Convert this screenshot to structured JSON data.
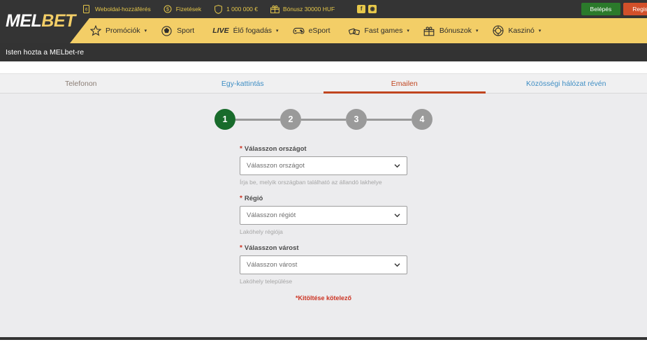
{
  "topbar": {
    "util_items": [
      {
        "icon": "mobile-access-icon",
        "label": "Weboldal-hozzáférés"
      },
      {
        "icon": "payments-dollar-icon",
        "label": "Fizetések"
      },
      {
        "icon": "shield-jackpot-icon",
        "label": "1 000 000 €"
      },
      {
        "icon": "gift-bonus-icon",
        "label": "Bónusz 30000 HUF"
      }
    ],
    "social": [
      {
        "icon": "facebook-icon",
        "glyph": "f"
      },
      {
        "icon": "instagram-icon",
        "glyph": "◉"
      }
    ],
    "login_label": "Belépés",
    "register_label": "Regis"
  },
  "brand": {
    "logo_part1": "MEL",
    "logo_part2": "BET"
  },
  "nav": {
    "items": [
      {
        "icon": "star-icon",
        "label": "Promóciók",
        "caret": "▾",
        "live": ""
      },
      {
        "icon": "soccer-ball-icon",
        "label": "Sport",
        "caret": "",
        "live": ""
      },
      {
        "icon": "live-text-icon",
        "label": "Élő fogadás",
        "caret": "▾",
        "live": "LIVE"
      },
      {
        "icon": "gamepad-icon",
        "label": "eSport",
        "caret": "",
        "live": ""
      },
      {
        "icon": "fast-games-icon",
        "label": "Fast games",
        "caret": "▾",
        "live": ""
      },
      {
        "icon": "gift-icon",
        "label": "Bónuszok",
        "caret": "▾",
        "live": ""
      },
      {
        "icon": "casino-chip-icon",
        "label": "Kaszinó",
        "caret": "▾",
        "live": ""
      }
    ]
  },
  "banner": {
    "text": "Isten hozta a MELbet-re"
  },
  "tabs": [
    {
      "label": "Telefonon",
      "state": "muted"
    },
    {
      "label": "Egy-kattintás",
      "state": "link"
    },
    {
      "label": "Emailen",
      "state": "active"
    },
    {
      "label": "Közösségi hálózat révén",
      "state": "link"
    }
  ],
  "steps": [
    {
      "number": "1",
      "state": "active"
    },
    {
      "number": "2",
      "state": "inactive"
    },
    {
      "number": "3",
      "state": "inactive"
    },
    {
      "number": "4",
      "state": "inactive"
    }
  ],
  "form": {
    "required_marker": "*",
    "fields": [
      {
        "label": "Válasszon országot",
        "value": "Válasszon országot",
        "helper": "Írja be, melyik országban található az állandó lakhelye"
      },
      {
        "label": "Régió",
        "value": "Válasszon régiót",
        "helper": "Lakóhely régiója"
      },
      {
        "label": "Válasszon várost",
        "value": "Válasszon várost",
        "helper": "Lakóhely települése"
      }
    ],
    "required_note": "*Kitöltése kötelező"
  },
  "colors": {
    "brand_yellow": "#f3ce67",
    "dark": "#343434",
    "accent_red": "#c0451f",
    "link_blue": "#3f8ec4",
    "step_active_green": "#186b2b",
    "login_green": "#2b7a2b",
    "register_orange": "#d2502a"
  }
}
